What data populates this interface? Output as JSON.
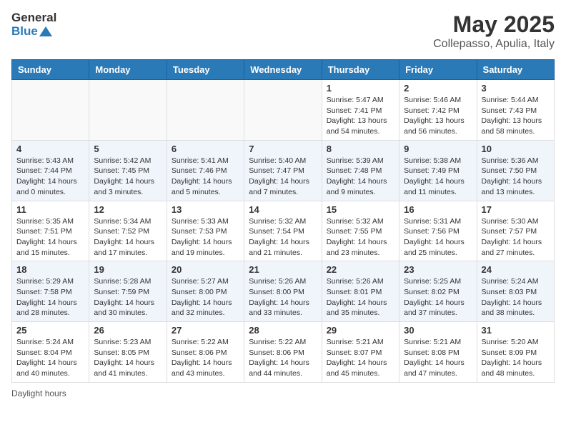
{
  "logo": {
    "general": "General",
    "blue": "Blue"
  },
  "header": {
    "month": "May 2025",
    "location": "Collepasso, Apulia, Italy"
  },
  "weekdays": [
    "Sunday",
    "Monday",
    "Tuesday",
    "Wednesday",
    "Thursday",
    "Friday",
    "Saturday"
  ],
  "weeks": [
    [
      {
        "day": "",
        "info": ""
      },
      {
        "day": "",
        "info": ""
      },
      {
        "day": "",
        "info": ""
      },
      {
        "day": "",
        "info": ""
      },
      {
        "day": "1",
        "info": "Sunrise: 5:47 AM\nSunset: 7:41 PM\nDaylight: 13 hours and 54 minutes."
      },
      {
        "day": "2",
        "info": "Sunrise: 5:46 AM\nSunset: 7:42 PM\nDaylight: 13 hours and 56 minutes."
      },
      {
        "day": "3",
        "info": "Sunrise: 5:44 AM\nSunset: 7:43 PM\nDaylight: 13 hours and 58 minutes."
      }
    ],
    [
      {
        "day": "4",
        "info": "Sunrise: 5:43 AM\nSunset: 7:44 PM\nDaylight: 14 hours and 0 minutes."
      },
      {
        "day": "5",
        "info": "Sunrise: 5:42 AM\nSunset: 7:45 PM\nDaylight: 14 hours and 3 minutes."
      },
      {
        "day": "6",
        "info": "Sunrise: 5:41 AM\nSunset: 7:46 PM\nDaylight: 14 hours and 5 minutes."
      },
      {
        "day": "7",
        "info": "Sunrise: 5:40 AM\nSunset: 7:47 PM\nDaylight: 14 hours and 7 minutes."
      },
      {
        "day": "8",
        "info": "Sunrise: 5:39 AM\nSunset: 7:48 PM\nDaylight: 14 hours and 9 minutes."
      },
      {
        "day": "9",
        "info": "Sunrise: 5:38 AM\nSunset: 7:49 PM\nDaylight: 14 hours and 11 minutes."
      },
      {
        "day": "10",
        "info": "Sunrise: 5:36 AM\nSunset: 7:50 PM\nDaylight: 14 hours and 13 minutes."
      }
    ],
    [
      {
        "day": "11",
        "info": "Sunrise: 5:35 AM\nSunset: 7:51 PM\nDaylight: 14 hours and 15 minutes."
      },
      {
        "day": "12",
        "info": "Sunrise: 5:34 AM\nSunset: 7:52 PM\nDaylight: 14 hours and 17 minutes."
      },
      {
        "day": "13",
        "info": "Sunrise: 5:33 AM\nSunset: 7:53 PM\nDaylight: 14 hours and 19 minutes."
      },
      {
        "day": "14",
        "info": "Sunrise: 5:32 AM\nSunset: 7:54 PM\nDaylight: 14 hours and 21 minutes."
      },
      {
        "day": "15",
        "info": "Sunrise: 5:32 AM\nSunset: 7:55 PM\nDaylight: 14 hours and 23 minutes."
      },
      {
        "day": "16",
        "info": "Sunrise: 5:31 AM\nSunset: 7:56 PM\nDaylight: 14 hours and 25 minutes."
      },
      {
        "day": "17",
        "info": "Sunrise: 5:30 AM\nSunset: 7:57 PM\nDaylight: 14 hours and 27 minutes."
      }
    ],
    [
      {
        "day": "18",
        "info": "Sunrise: 5:29 AM\nSunset: 7:58 PM\nDaylight: 14 hours and 28 minutes."
      },
      {
        "day": "19",
        "info": "Sunrise: 5:28 AM\nSunset: 7:59 PM\nDaylight: 14 hours and 30 minutes."
      },
      {
        "day": "20",
        "info": "Sunrise: 5:27 AM\nSunset: 8:00 PM\nDaylight: 14 hours and 32 minutes."
      },
      {
        "day": "21",
        "info": "Sunrise: 5:26 AM\nSunset: 8:00 PM\nDaylight: 14 hours and 33 minutes."
      },
      {
        "day": "22",
        "info": "Sunrise: 5:26 AM\nSunset: 8:01 PM\nDaylight: 14 hours and 35 minutes."
      },
      {
        "day": "23",
        "info": "Sunrise: 5:25 AM\nSunset: 8:02 PM\nDaylight: 14 hours and 37 minutes."
      },
      {
        "day": "24",
        "info": "Sunrise: 5:24 AM\nSunset: 8:03 PM\nDaylight: 14 hours and 38 minutes."
      }
    ],
    [
      {
        "day": "25",
        "info": "Sunrise: 5:24 AM\nSunset: 8:04 PM\nDaylight: 14 hours and 40 minutes."
      },
      {
        "day": "26",
        "info": "Sunrise: 5:23 AM\nSunset: 8:05 PM\nDaylight: 14 hours and 41 minutes."
      },
      {
        "day": "27",
        "info": "Sunrise: 5:22 AM\nSunset: 8:06 PM\nDaylight: 14 hours and 43 minutes."
      },
      {
        "day": "28",
        "info": "Sunrise: 5:22 AM\nSunset: 8:06 PM\nDaylight: 14 hours and 44 minutes."
      },
      {
        "day": "29",
        "info": "Sunrise: 5:21 AM\nSunset: 8:07 PM\nDaylight: 14 hours and 45 minutes."
      },
      {
        "day": "30",
        "info": "Sunrise: 5:21 AM\nSunset: 8:08 PM\nDaylight: 14 hours and 47 minutes."
      },
      {
        "day": "31",
        "info": "Sunrise: 5:20 AM\nSunset: 8:09 PM\nDaylight: 14 hours and 48 minutes."
      }
    ]
  ],
  "footer": {
    "daylight_label": "Daylight hours"
  }
}
